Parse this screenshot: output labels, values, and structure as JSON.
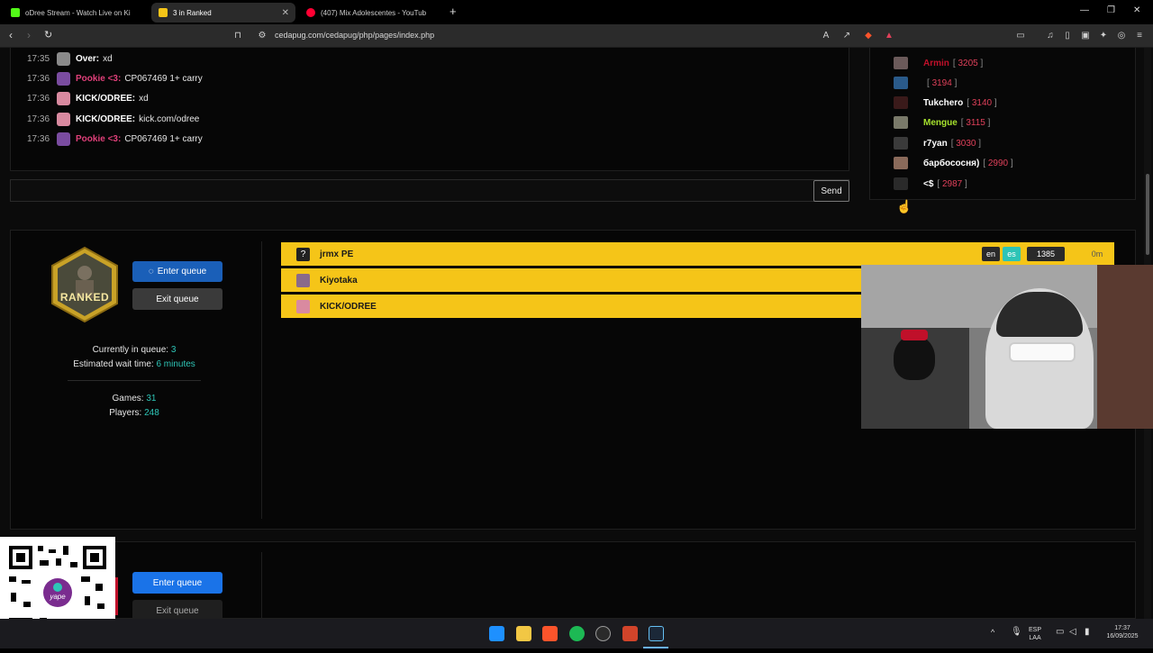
{
  "browser": {
    "tabs": [
      {
        "label": "oDree Stream - Watch Live on Ki",
        "active": false
      },
      {
        "label": "3 in Ranked",
        "active": true
      },
      {
        "label": "(407) Mix Adolescentes - YouTub",
        "active": false
      }
    ],
    "new_tab_icon": "plus-icon",
    "url": "cedapug.com/cedapug/php/pages/index.php"
  },
  "chat": {
    "messages": [
      {
        "time": "17:35",
        "user": "Over:",
        "text": "xd",
        "user_color": "#ffffff",
        "avatar_color": "#8a8a8a"
      },
      {
        "time": "17:36",
        "user": "Pookie <3:",
        "text": "CP067469 1+ carry",
        "user_color": "#e0407a",
        "avatar_color": "#7a4ca0"
      },
      {
        "time": "17:36",
        "user": "KICK/ODREE:",
        "text": "xd",
        "user_color": "#ffffff",
        "avatar_color": "#d98aa0"
      },
      {
        "time": "17:36",
        "user": "KICK/ODREE:",
        "text": "kick.com/odree",
        "user_color": "#ffffff",
        "avatar_color": "#d98aa0"
      },
      {
        "time": "17:36",
        "user": "Pookie <3:",
        "text": "CP067469 1+ carry",
        "user_color": "#e0407a",
        "avatar_color": "#7a4ca0"
      }
    ],
    "send_label": "Send"
  },
  "leaderboard": {
    "rows": [
      {
        "name": "Armin",
        "score": "3205",
        "name_color": "#c0102a"
      },
      {
        "name": "",
        "score": "3194",
        "name_color": "#ffffff"
      },
      {
        "name": "Tukchero",
        "score": "3140",
        "name_color": "#ffffff"
      },
      {
        "name": "Mengue",
        "score": "3115",
        "name_color": "#a6e22e"
      },
      {
        "name": "r7yan",
        "score": "3030",
        "name_color": "#ffffff"
      },
      {
        "name": "барбососня)",
        "score": "2990",
        "name_color": "#ffffff"
      },
      {
        "name": "<$",
        "score": "2987",
        "name_color": "#ffffff"
      }
    ]
  },
  "queue": {
    "badge_text": "RANKED",
    "enter_label": "Enter queue",
    "exit_label": "Exit queue",
    "currently_label": "Currently in queue:",
    "currently_value": "3",
    "wait_label": "Estimated wait time:",
    "wait_value": "6 minutes",
    "games_label": "Games:",
    "games_value": "31",
    "players_label": "Players:",
    "players_value": "248",
    "entries": [
      {
        "name": "jrmx PE",
        "lang1": "en",
        "lang2": "es",
        "rating": "1385",
        "time": "0m"
      },
      {
        "name": "Kiyotaka"
      },
      {
        "name": "KICK/ODREE"
      }
    ]
  },
  "lower": {
    "enter_label": "Enter queue",
    "exit_label": "Exit queue"
  },
  "qr": {
    "label": "yape"
  },
  "taskbar": {
    "lang": "ESP",
    "region": "LAA",
    "time": "17:37",
    "date": "16/09/2025"
  }
}
